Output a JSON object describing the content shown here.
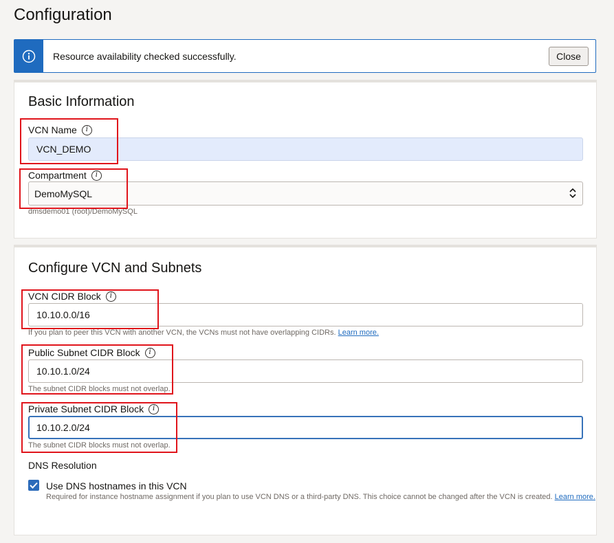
{
  "page": {
    "title": "Configuration"
  },
  "banner": {
    "message": "Resource availability checked successfully.",
    "close_label": "Close",
    "icon": "info-icon"
  },
  "basic": {
    "title": "Basic Information",
    "vcn_name_label": "VCN Name",
    "vcn_name_value": "VCN_DEMO",
    "compartment_label": "Compartment",
    "compartment_value": "DemoMySQL",
    "compartment_path": "dmsdemo01 (root)/DemoMySQL"
  },
  "subnets": {
    "title": "Configure VCN and Subnets",
    "vcn_cidr_label": "VCN CIDR Block",
    "vcn_cidr_value": "10.10.0.0/16",
    "vcn_cidr_help": "If you plan to peer this VCN with another VCN, the VCNs must not have overlapping CIDRs.",
    "vcn_cidr_learn_more": "Learn more.",
    "public_label": "Public Subnet CIDR Block",
    "public_value": "10.10.1.0/24",
    "public_help": "The subnet CIDR blocks must not overlap.",
    "private_label": "Private Subnet CIDR Block",
    "private_value": "10.10.2.0/24",
    "private_help": "The subnet CIDR blocks must not overlap.",
    "dns_heading": "DNS Resolution",
    "dns_checkbox_label": "Use DNS hostnames in this VCN",
    "dns_checked": true,
    "dns_help": "Required for instance hostname assignment if you plan to use VCN DNS or a third-party DNS. This choice cannot be changed after the VCN is created.",
    "dns_learn_more": "Learn more."
  },
  "colors": {
    "accent": "#1f6bbf",
    "highlight_box": "#e0141b",
    "prefilled_input": "#e3ebfc"
  }
}
